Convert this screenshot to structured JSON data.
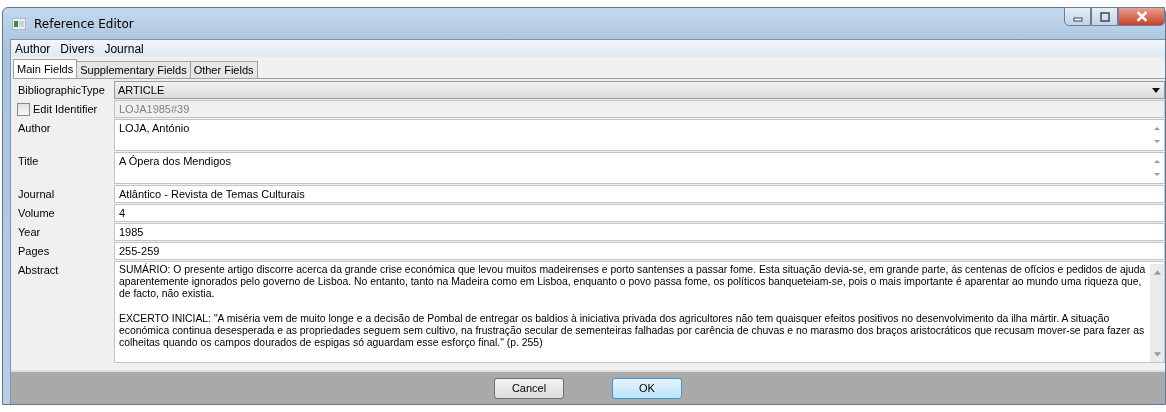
{
  "window": {
    "title": "Reference Editor"
  },
  "menu": [
    "Author",
    "Divers",
    "Journal"
  ],
  "tabs": [
    {
      "label": "Main Fields",
      "selected": true
    },
    {
      "label": "Supplementary Fields",
      "selected": false
    },
    {
      "label": "Other Fields",
      "selected": false
    }
  ],
  "fields": [
    {
      "kind": "combo",
      "label": "BibliographicType",
      "value": "ARTICLE"
    },
    {
      "kind": "identifier",
      "label": "Edit Identifier",
      "checked": false,
      "value": "LOJA1985#39"
    },
    {
      "kind": "multiline",
      "label": "Author",
      "value": "LOJA, António"
    },
    {
      "kind": "multiline",
      "label": "Title",
      "value": "A Ópera dos Mendigos"
    },
    {
      "kind": "line",
      "label": "Journal",
      "value": "Atlântico - Revista de Temas Culturais"
    },
    {
      "kind": "line",
      "label": "Volume",
      "value": "4"
    },
    {
      "kind": "line",
      "label": "Year",
      "value": "1985"
    },
    {
      "kind": "line",
      "label": "Pages",
      "value": "255-259"
    },
    {
      "kind": "textarea",
      "label": "Abstract",
      "paragraphs": [
        "SUMÁRIO: O presente artigo discorre acerca da grande crise económica que levou muitos madeirenses  e porto santenses a passar fome. Esta situação devia-se, em grande parte, ás centenas de ofícios e pedidos de ajuda aparentemente ignorados pelo governo de Lisboa. No entanto, tanto na Madeira como em Lisboa, enquanto o povo passa fome, os políticos banqueteiam-se, pois o mais importante é aparentar ao mundo uma riqueza que, de facto, não existia.",
        "EXCERTO INICIAL: \"A miséria vem de muito longe e a decisão de Pombal de entregar os baldios à iniciativa privada dos agricultores não tem quaisquer efeitos positivos no desenvolvimento da ilha mártir. A situação económica continua desesperada e as propriedades seguem sem cultivo, na frustração secular de sementeiras falhadas por carência de chuvas e no marasmo dos braços aristocráticos que recusam mover-se para fazer as colheitas quando os campos dourados de espigas só aguardam esse esforço final.\" (p. 255)"
      ]
    }
  ],
  "buttons": [
    {
      "label": "Cancel",
      "default": false
    },
    {
      "label": "OK",
      "default": true
    }
  ]
}
